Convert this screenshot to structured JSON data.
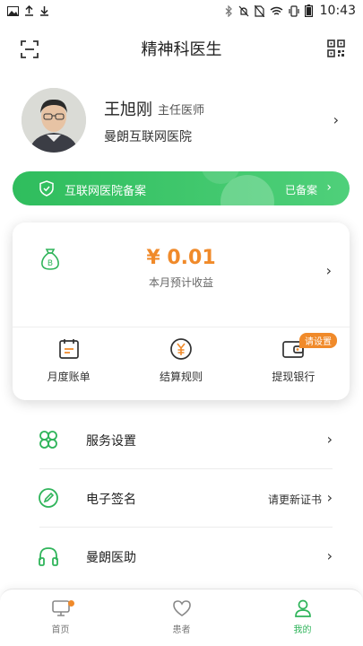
{
  "status_bar": {
    "time": "10:43",
    "left_icons": [
      "image-icon",
      "upload-icon",
      "download-icon"
    ],
    "right_icons": [
      "bluetooth-icon",
      "mute-icon",
      "no-sim-icon",
      "wifi-icon",
      "vibrate-icon",
      "battery-icon"
    ]
  },
  "header": {
    "title": "精神科医生",
    "left_icon": "scan-icon",
    "right_icon": "qr-code-icon"
  },
  "profile": {
    "name": "王旭刚",
    "title": "主任医师",
    "hospital": "曼朗互联网医院"
  },
  "banner": {
    "text": "互联网医院备案",
    "status": "已备案",
    "icon": "shield-check-icon"
  },
  "earnings": {
    "amount": "¥ 0.01",
    "subtitle": "本月预计收益",
    "icon": "money-bag-icon",
    "ops": [
      {
        "label": "月度账单",
        "icon": "calendar-icon"
      },
      {
        "label": "结算规则",
        "icon": "yuan-coin-icon"
      },
      {
        "label": "提现银行",
        "icon": "wallet-icon",
        "badge": "请设置"
      }
    ]
  },
  "menu": [
    {
      "label": "服务设置",
      "icon": "clover-icon",
      "extra": ""
    },
    {
      "label": "电子签名",
      "icon": "pen-icon",
      "extra": "请更新证书"
    },
    {
      "label": "曼朗医助",
      "icon": "headset-icon",
      "extra": ""
    }
  ],
  "tabs": [
    {
      "label": "首页",
      "icon": "monitor-icon"
    },
    {
      "label": "患者",
      "icon": "heart-icon"
    },
    {
      "label": "我的",
      "icon": "user-icon",
      "active": true
    }
  ],
  "colors": {
    "brand_green": "#2fbd5d",
    "accent_orange": "#f08a2a"
  }
}
